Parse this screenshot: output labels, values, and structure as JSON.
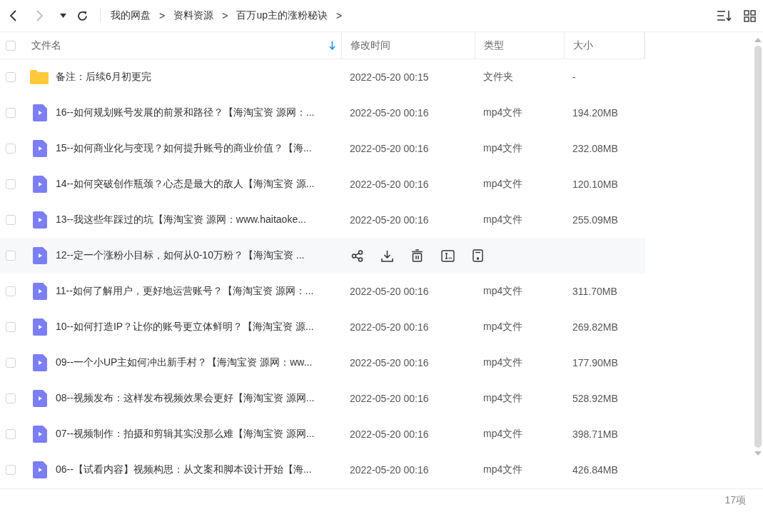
{
  "breadcrumb": [
    "我的网盘",
    "资料资源",
    "百万up主的涨粉秘诀"
  ],
  "breadcrumb_separator": ">",
  "table": {
    "select_all": {
      "checked": false
    },
    "columns": [
      {
        "label": "文件名",
        "sorted": true
      },
      {
        "label": "修改时间",
        "sorted": false
      },
      {
        "label": "类型",
        "sorted": false
      },
      {
        "label": "大小",
        "sorted": false
      }
    ],
    "rows": [
      {
        "kind": "folder",
        "checked": false,
        "hovered": false,
        "name": "备注：后续6月初更完",
        "modified": "2022-05-20 00:15",
        "type": "文件夹",
        "size": "-"
      },
      {
        "kind": "video",
        "checked": false,
        "hovered": false,
        "name": "16--如何规划账号发展的前景和路径？【海淘宝资 源网：...",
        "modified": "2022-05-20 00:16",
        "type": "mp4文件",
        "size": "194.20MB"
      },
      {
        "kind": "video",
        "checked": false,
        "hovered": false,
        "name": "15--如何商业化与变现？如何提升账号的商业价值？【海...",
        "modified": "2022-05-20 00:16",
        "type": "mp4文件",
        "size": "232.08MB"
      },
      {
        "kind": "video",
        "checked": false,
        "hovered": false,
        "name": "14--如何突破创作瓶颈？心态是最大的敌人【海淘宝资 源...",
        "modified": "2022-05-20 00:16",
        "type": "mp4文件",
        "size": "120.10MB"
      },
      {
        "kind": "video",
        "checked": false,
        "hovered": false,
        "name": "13--我这些年踩过的坑【海淘宝资 源网：www.haitaoke...",
        "modified": "2022-05-20 00:16",
        "type": "mp4文件",
        "size": "255.09MB"
      },
      {
        "kind": "video",
        "checked": false,
        "hovered": true,
        "name": "12--定一个涨粉小目标，如何从0-10万粉？【海淘宝资 ..."
      },
      {
        "kind": "video",
        "checked": false,
        "hovered": false,
        "name": "11--如何了解用户，更好地运营账号？【海淘宝资 源网：...",
        "modified": "2022-05-20 00:16",
        "type": "mp4文件",
        "size": "311.70MB"
      },
      {
        "kind": "video",
        "checked": false,
        "hovered": false,
        "name": "10--如何打造IP？让你的账号更立体鲜明？【海淘宝资 源...",
        "modified": "2022-05-20 00:16",
        "type": "mp4文件",
        "size": "269.82MB"
      },
      {
        "kind": "video",
        "checked": false,
        "hovered": false,
        "name": "09--一个小UP主如何冲出新手村？【海淘宝资 源网：ww...",
        "modified": "2022-05-20 00:16",
        "type": "mp4文件",
        "size": "177.90MB"
      },
      {
        "kind": "video",
        "checked": false,
        "hovered": false,
        "name": "08--视频发布：这样发布视频效果会更好【海淘宝资 源网...",
        "modified": "2022-05-20 00:16",
        "type": "mp4文件",
        "size": "528.92MB"
      },
      {
        "kind": "video",
        "checked": false,
        "hovered": false,
        "name": "07--视频制作：拍摄和剪辑其实没那么难【海淘宝资 源网...",
        "modified": "2022-05-20 00:16",
        "type": "mp4文件",
        "size": "398.71MB"
      },
      {
        "kind": "video",
        "checked": false,
        "hovered": false,
        "name": "06--【试看内容】视频构思：从文案和脚本设计开始【海...",
        "modified": "2022-05-20 00:16",
        "type": "mp4文件",
        "size": "426.84MB"
      }
    ]
  },
  "status_bar": {
    "count": "17项"
  }
}
